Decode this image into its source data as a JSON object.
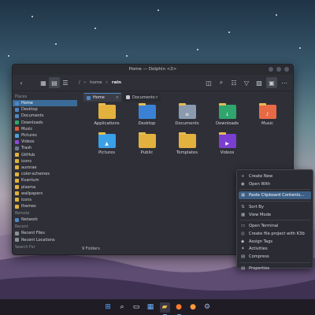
{
  "window": {
    "title": "Home — Dolphin <2>"
  },
  "toolbar": {
    "back_icon": "back-arrow-icon",
    "breadcrumb": [
      "/",
      "home",
      "rain"
    ],
    "breadcrumb_sep": ">"
  },
  "sidebar": {
    "sections": [
      {
        "header": "Places",
        "items": [
          {
            "label": "Home",
            "icon": "home-icon",
            "color": "#4d86c6",
            "selected": true
          },
          {
            "label": "Desktop",
            "icon": "desktop-icon",
            "color": "#4d86c6"
          },
          {
            "label": "Documents",
            "icon": "documents-icon",
            "color": "#4d86c6"
          },
          {
            "label": "Downloads",
            "icon": "downloads-icon",
            "color": "#2ea66d"
          },
          {
            "label": "Music",
            "icon": "music-icon",
            "color": "#e05a3a"
          },
          {
            "label": "Pictures",
            "icon": "pictures-icon",
            "color": "#4aa3e0"
          },
          {
            "label": "Videos",
            "icon": "videos-icon",
            "color": "#8a4ad8"
          },
          {
            "label": "Trash",
            "icon": "trash-icon",
            "color": "#6a7a90"
          },
          {
            "label": "GitHub",
            "icon": "folder-icon",
            "color": "#e2b13e"
          },
          {
            "label": "icons",
            "icon": "folder-icon",
            "color": "#e2b13e"
          },
          {
            "label": "aurorae",
            "icon": "folder-icon",
            "color": "#e2b13e"
          },
          {
            "label": "color-schemes",
            "icon": "folder-icon",
            "color": "#e2b13e"
          },
          {
            "label": "Kvantum",
            "icon": "folder-icon",
            "color": "#e2b13e"
          },
          {
            "label": "plasma",
            "icon": "folder-icon",
            "color": "#e2b13e"
          },
          {
            "label": "wallpapers",
            "icon": "folder-icon",
            "color": "#e2b13e"
          },
          {
            "label": "icons",
            "icon": "folder-icon",
            "color": "#e2b13e"
          },
          {
            "label": "themes",
            "icon": "folder-icon",
            "color": "#e2b13e"
          }
        ]
      },
      {
        "header": "Remote",
        "items": [
          {
            "label": "Network",
            "icon": "network-icon",
            "color": "#4d86c6"
          }
        ]
      },
      {
        "header": "Recent",
        "items": [
          {
            "label": "Recent Files",
            "icon": "recent-files-icon",
            "color": "#8c9099"
          },
          {
            "label": "Recent Locations",
            "icon": "recent-locations-icon",
            "color": "#8c9099"
          }
        ]
      },
      {
        "header": "Search For",
        "items": []
      }
    ]
  },
  "tabs": [
    {
      "label": "Home",
      "icon": "home-icon",
      "active": true
    },
    {
      "label": "Documents",
      "icon": "documents-icon",
      "active": false
    }
  ],
  "tab_close_glyph": "×",
  "files": [
    {
      "label": "Applications",
      "color": "#e2b13e",
      "glyph": ""
    },
    {
      "label": "Desktop",
      "color": "#3b82d6",
      "glyph": ""
    },
    {
      "label": "Documents",
      "color": "#8a9bb0",
      "glyph": "≡"
    },
    {
      "label": "Downloads",
      "color": "#2ea66d",
      "glyph": "↓"
    },
    {
      "label": "Music",
      "color": "#e86a45",
      "glyph": "♪"
    },
    {
      "label": "Pictures",
      "color": "#3aa0e8",
      "glyph": "▲"
    },
    {
      "label": "Public",
      "color": "#e2b13e",
      "glyph": ""
    },
    {
      "label": "Templates",
      "color": "#e2b13e",
      "glyph": ""
    },
    {
      "label": "Videos",
      "color": "#7a3ed0",
      "glyph": "▶"
    }
  ],
  "status": {
    "text": "9 Folders",
    "zoom_fraction": 0.3
  },
  "context_menu": {
    "items": [
      {
        "label": "Create New",
        "icon": "plus-icon",
        "glyph": "+"
      },
      {
        "label": "Open With",
        "icon": "open-with-icon",
        "glyph": "◉"
      },
      {
        "sep": true
      },
      {
        "label": "Paste Clipboard Contents...",
        "icon": "paste-icon",
        "glyph": "▣",
        "highlight": true
      },
      {
        "sep": true
      },
      {
        "label": "Sort By",
        "icon": "sort-icon",
        "glyph": "⇅"
      },
      {
        "label": "View Mode",
        "icon": "view-mode-icon",
        "glyph": "▦"
      },
      {
        "sep": true
      },
      {
        "label": "Open Terminal",
        "icon": "terminal-icon",
        "glyph": "▭"
      },
      {
        "label": "Create file project with K3b",
        "icon": "k3b-icon",
        "glyph": "◎"
      },
      {
        "label": "Assign Tags",
        "icon": "tag-icon",
        "glyph": "◆"
      },
      {
        "label": "Activities",
        "icon": "activities-icon",
        "glyph": "✦"
      },
      {
        "label": "Compress",
        "icon": "compress-icon",
        "glyph": "▤"
      },
      {
        "sep": true
      },
      {
        "label": "Properties",
        "icon": "properties-icon",
        "glyph": "▤"
      }
    ]
  },
  "taskbar": [
    {
      "name": "start-menu-icon",
      "glyph": "⊞",
      "color": "#4fa7ff"
    },
    {
      "name": "search-icon",
      "glyph": "⌕",
      "color": "#e6e6ee"
    },
    {
      "name": "task-view-icon",
      "glyph": "▭",
      "color": "#e6e6ee"
    },
    {
      "name": "widgets-icon",
      "glyph": "▦",
      "color": "#6ab4ff"
    },
    {
      "name": "file-manager-icon",
      "glyph": "▰",
      "color": "#f0c040",
      "focus": true,
      "run": true
    },
    {
      "name": "firefox-icon",
      "glyph": "●",
      "color": "#ff7b2e",
      "run": true
    },
    {
      "name": "browser-icon",
      "glyph": "●",
      "color": "#ff9a3c"
    },
    {
      "name": "settings-icon",
      "glyph": "⚙",
      "color": "#9fb4d8"
    }
  ]
}
